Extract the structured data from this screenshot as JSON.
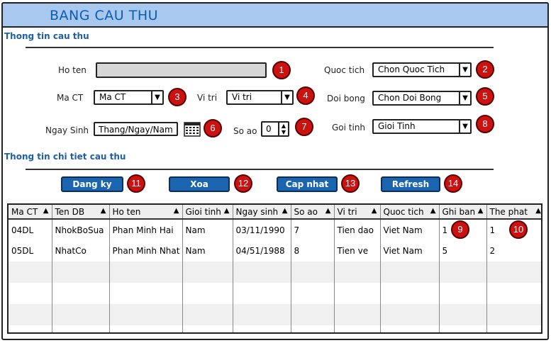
{
  "window": {
    "title": "BANG CAU THU"
  },
  "section1": {
    "title": "Thong tin cau thu"
  },
  "section2": {
    "title": "Thong tin chi tiet cau thu"
  },
  "form": {
    "ho_ten": {
      "label": "Ho ten",
      "value": ""
    },
    "quoc_tich": {
      "label": "Quoc tich",
      "value": "Chon Quoc Tich"
    },
    "ma_ct": {
      "label": "Ma CT",
      "value": "Ma CT"
    },
    "vi_tri": {
      "label": "Vi tri",
      "value": "Vi tri"
    },
    "doi_bong": {
      "label": "Doi bong",
      "value": "Chon Doi Bong"
    },
    "ngay_sinh": {
      "label": "Ngay Sinh",
      "value": "Thang/Ngay/Nam"
    },
    "so_ao": {
      "label": "So ao",
      "value": "0"
    },
    "gioi_tinh": {
      "label": "Goi tinh",
      "value": "Gioi Tinh"
    }
  },
  "buttons": {
    "dang_ky": "Dang ky",
    "xoa": "Xoa",
    "cap_nhat": "Cap nhat",
    "refresh": "Refresh"
  },
  "badges": [
    "1",
    "2",
    "3",
    "4",
    "5",
    "6",
    "7",
    "8",
    "9",
    "10",
    "11",
    "12",
    "13",
    "14"
  ],
  "table": {
    "columns": [
      "Ma CT",
      "Ten DB",
      "Ho ten",
      "Gioi tinh",
      "Ngay sinh",
      "So ao",
      "Vi tri",
      "Quoc tich",
      "Ghi ban",
      "The phat"
    ],
    "rows": [
      [
        "04DL",
        "NhokBoSua",
        "Phan Minh Hai",
        "Nam",
        "03/11/1990",
        "7",
        "Tien dao",
        "Viet Nam",
        "1",
        "1"
      ],
      [
        "05DL",
        "NhatCo",
        "Phan Minh Nhat",
        "Nam",
        "04/51/1988",
        "8",
        "Tien ve",
        "Viet Nam",
        "5",
        "2"
      ]
    ]
  },
  "icons": {
    "sort": "triangle-up",
    "dropdown": "triangle-down",
    "calendar": "calendar-icon",
    "spinner": "up-down-arrows"
  },
  "colors": {
    "titlebar": "#a8c8ef",
    "title_text": "#0b5db0",
    "section_text": "#1f5fa8",
    "button": "#1a64b0",
    "badge": "#cc1111"
  }
}
